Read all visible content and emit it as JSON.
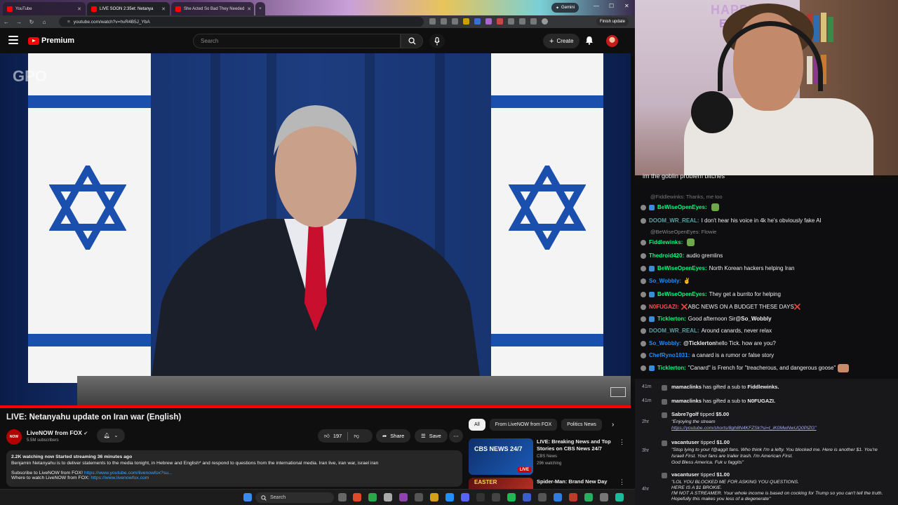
{
  "browser": {
    "tabs": [
      {
        "title": "YouTube"
      },
      {
        "title": "LIVE SOON 2:35et: Netanya"
      },
      {
        "title": "She Acted So Bad They Needed"
      }
    ],
    "gemini_label": "Gemini",
    "url": "youtube.com/watch?v=hvR4B5J_YbA",
    "finish_update_label": "Finish update"
  },
  "youtube": {
    "logo": "Premium",
    "search_placeholder": "Search",
    "create_label": "Create",
    "video": {
      "title": "LIVE: Netanyahu update on Iran war (English)",
      "watermark": "GPO",
      "channel": {
        "avatar_text": "NOW",
        "name": "LiveNOW from FOX",
        "subscribers": "5.5M subscribers"
      },
      "likes": "197",
      "share_label": "Share",
      "save_label": "Save",
      "description": {
        "meta": "2.2K watching now  Started streaming 36 minutes ago",
        "text": "Benjamin Netanyahu is to deliver statements to the media tonight, in Hebrew and English* and respond to questions from the international media. Iran live, iran war, israel iran",
        "subscribe_text": "Subscribe to LiveNOW from FOX!",
        "subscribe_link": "https://www.youtube.com/livenowfox?su...",
        "where_text": "Where to watch LiveNOW from FOX:",
        "where_link": "https://www.livenowfox.com"
      }
    },
    "chips": [
      "All",
      "From LiveNOW from FOX",
      "Politics News"
    ],
    "recommendations": [
      {
        "thumb_label": "CBS NEWS 24/7",
        "live_badge": "LIVE",
        "title": "LIVE: Breaking News and Top Stories on CBS News 24/7",
        "channel": "CBS News",
        "views": "296 watching"
      },
      {
        "thumb_label": "EASTER",
        "title": "Spider-Man: Brand New Day",
        "channel": "",
        "views": ""
      }
    ]
  },
  "taskbar": {
    "search_label": "Search"
  },
  "stream": {
    "overlay_happy": "HAPPY",
    "overlay_easter": "EAST",
    "caption": "im the goblin problem bitches"
  },
  "chat": {
    "hint": "@Fiddlewinks: Thanks, me too",
    "messages": [
      {
        "user": "BeWiseOpenEyes:",
        "text": "",
        "color": "#00ff7f",
        "emote": true
      },
      {
        "user": "DOOM_WR_REAL:",
        "text": "I don't hear his voice in 4k he's obviously fake AI",
        "color": "#5f9ea0"
      },
      {
        "reply": "@BeWiseOpenEyes: Flowie"
      },
      {
        "user": "Fiddlewinks:",
        "text": "",
        "color": "#00ff7f",
        "emote": true
      },
      {
        "user": "Thedroid420:",
        "text": "audio gremlins",
        "color": "#00ff7f"
      },
      {
        "user": "BeWiseOpenEyes:",
        "text": "North Korean hackers helping Iran",
        "color": "#00ff7f"
      },
      {
        "user": "So_Wobbly:",
        "text": "✌",
        "color": "#1e90ff"
      },
      {
        "user": "BeWiseOpenEyes:",
        "text": "They get a burrito for helping",
        "color": "#00ff7f"
      },
      {
        "user": "N0FUGAZI:",
        "text": "❌ABC NEWS ON A BUDGET THESE DAYS❌",
        "color": "#ff4f4f"
      },
      {
        "user": "Ticklerton:",
        "text": "Good afternoon Sir ",
        "mention": "@So_Wobbly",
        "color": "#00ff7f"
      },
      {
        "user": "DOOM_WR_REAL:",
        "text": "Around canards, never relax",
        "color": "#5f9ea0"
      },
      {
        "user": "So_Wobbly:",
        "text": " hello Tick. how are you?",
        "mention": "@Ticklerton",
        "color": "#1e90ff"
      },
      {
        "user": "ChefRyno1031:",
        "text": "a canard is a rumor or false story",
        "color": "#1e90ff"
      },
      {
        "user": "Ticklerton:",
        "text": "\"Canard\" is French for \"treacherous, and dangerous goose\"",
        "color": "#00ff7f"
      }
    ]
  },
  "events": [
    {
      "time": "41m",
      "user": "mamaclinks",
      "action": " has gifted a sub to ",
      "target": "Fiddlewinks."
    },
    {
      "time": "41m",
      "user": "mamaclinks",
      "action": " has gifted a sub to ",
      "target": "N0FUGAZI."
    },
    {
      "time": "2hr",
      "user": "Sabre7golf",
      "action": " tipped ",
      "target": "$5.00",
      "lines": [
        "\"Enjoying the stream",
        "https://youtube.com/shorts/8gh8N4KFZSk?si=t_iK0MwNwUQ0PlZG\""
      ]
    },
    {
      "time": "3hr",
      "user": "vacantuser",
      "action": " tipped ",
      "target": "$1.00",
      "lines": [
        "\"Stop lying to your f@aggit fans. Who think I'm a lefty. You blocked me. Here is another $1. You're",
        "Israeli First. Your fans are trailer trash. I'm American First.",
        "God Bless America. Fuk u faggits\""
      ]
    },
    {
      "time": "4hr",
      "user": "vacantuser",
      "action": " tipped ",
      "target": "$1.00",
      "lines": [
        "\"LOL YOU BLOCKED ME FOR ASKING YOU QUESTIONS.",
        "HERE IS A $1 BROKIE.",
        "I'M NOT A STREAMER. Your whole income is based on cocking for Trump so you can't tell the truth.",
        "Hopefully this makes you less of a degenerate\""
      ]
    }
  ]
}
